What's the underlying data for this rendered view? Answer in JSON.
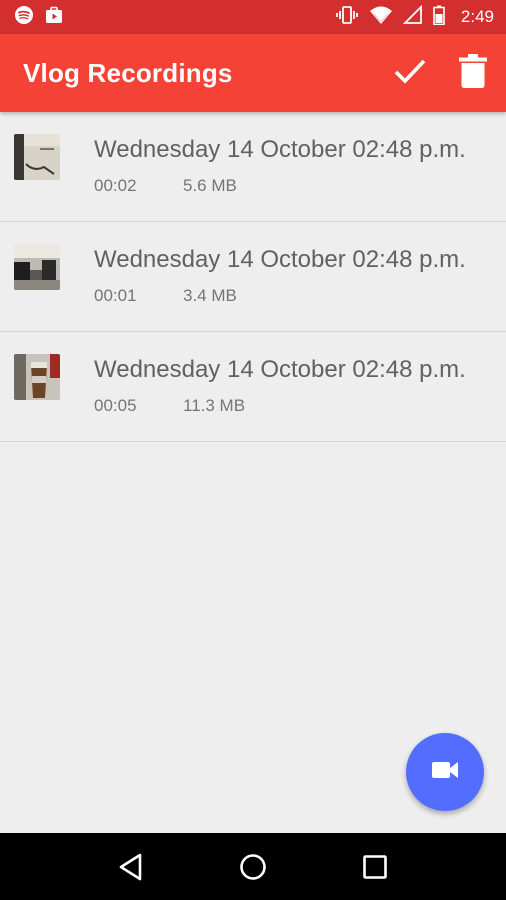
{
  "status_bar": {
    "time": "2:49",
    "icons": [
      "spotify-icon",
      "briefcase-icon",
      "vibrate-icon",
      "wifi-icon",
      "no-sim-icon",
      "battery-icon"
    ]
  },
  "app_bar": {
    "title": "Vlog Recordings",
    "actions": [
      "check-icon",
      "delete-icon"
    ],
    "color": "#f44336"
  },
  "recordings": [
    {
      "title": "Wednesday 14 October 02:48 p.m.",
      "duration": "00:02",
      "size": "5.6 MB"
    },
    {
      "title": "Wednesday 14 October 02:48 p.m.",
      "duration": "00:01",
      "size": "3.4 MB"
    },
    {
      "title": "Wednesday 14 October 02:48 p.m.",
      "duration": "00:05",
      "size": "11.3 MB"
    }
  ],
  "fab": {
    "icon": "videocam-icon",
    "color": "#536dfe"
  },
  "nav_bar": {
    "icons": [
      "back-icon",
      "home-icon",
      "recents-icon"
    ]
  }
}
